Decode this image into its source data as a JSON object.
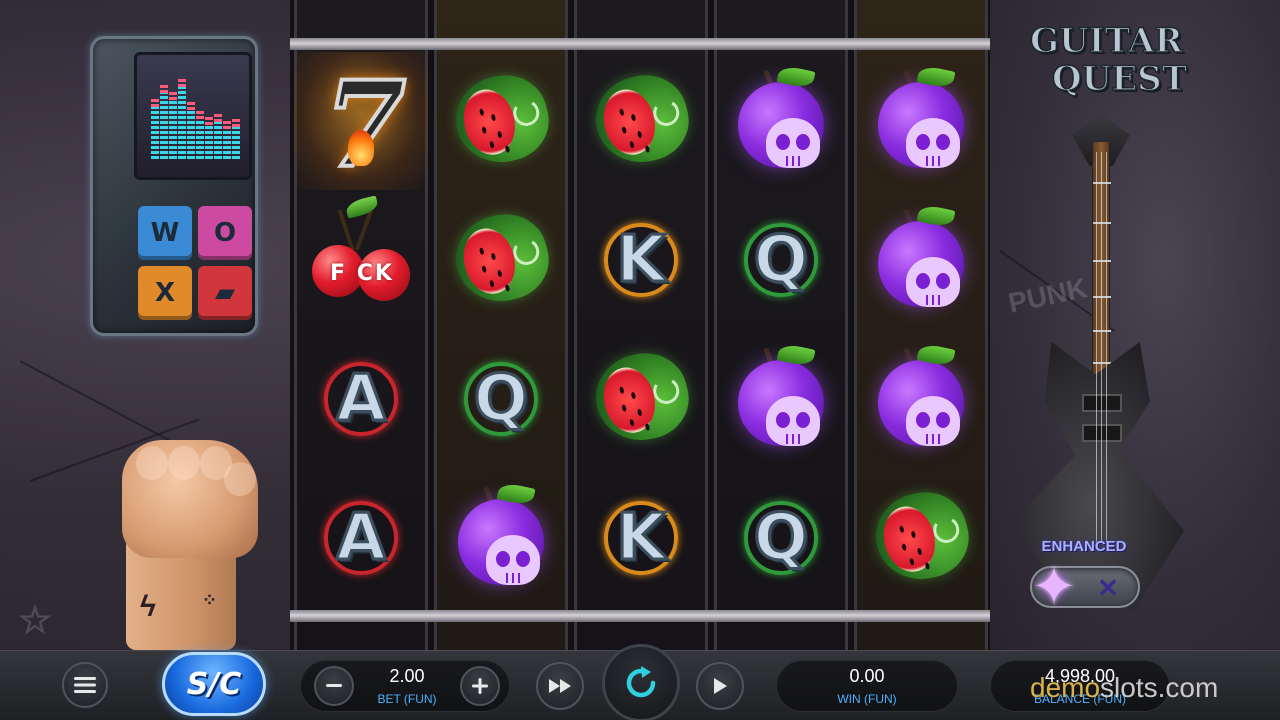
{
  "game": {
    "logo_line1": "GUITAR",
    "logo_line2": "QUEST",
    "enhanced_label": "ENHANCED",
    "background_scribble": "PUNK"
  },
  "reels": [
    [
      "seven",
      "cherry",
      "A",
      "A"
    ],
    [
      "watermelon",
      "watermelon",
      "Q",
      "plum"
    ],
    [
      "watermelon",
      "K",
      "watermelon",
      "K"
    ],
    [
      "plum",
      "Q",
      "plum",
      "Q"
    ],
    [
      "plum",
      "plum",
      "plum",
      "watermelon"
    ]
  ],
  "symbols": {
    "seven_text": "7",
    "cherry_text": "F CK",
    "A": "A",
    "K": "K",
    "Q": "Q"
  },
  "card_ring_colors": {
    "A": "#c8262c",
    "K": "#d98a1c",
    "Q": "#2f9a3a"
  },
  "speaker_buttons": [
    {
      "glyph": "W",
      "color": "#3a8ad6"
    },
    {
      "glyph": "O",
      "color": "#cc4aa0"
    },
    {
      "glyph": "X",
      "color": "#e08a2a"
    },
    {
      "glyph": "▰",
      "color": "#d0363c"
    }
  ],
  "controls": {
    "menu_icon": "hamburger-icon",
    "currency_badge": "S/C",
    "bet_value": "2.00",
    "bet_label": "BET (FUN)",
    "win_value": "0.00",
    "win_label": "WIN (FUN)",
    "balance_value": "4,998.00",
    "balance_label": "BALANCE (FUN)",
    "minus_icon": "minus-icon",
    "plus_icon": "plus-icon",
    "turbo_icon": "fast-forward-icon",
    "spin_icon": "refresh-icon",
    "autoplay_icon": "play-icon"
  },
  "watermark": {
    "part1": "demo",
    "part2": "slots.com"
  },
  "colors": {
    "accent_blue": "#4fb0ff",
    "spin_cyan": "#2fd0e0",
    "highlight_orange": "#ffaa28"
  }
}
